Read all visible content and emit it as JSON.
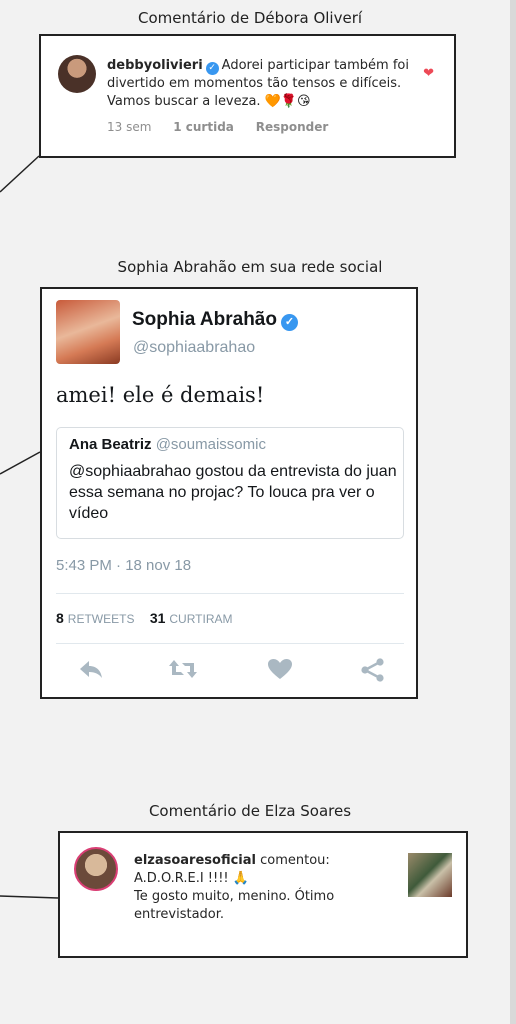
{
  "captions": {
    "debora": "Comentário de Débora Oliverí",
    "sophia": "Sophia Abrahão em sua rede social",
    "elza": "Comentário de Elza Soares"
  },
  "comment1": {
    "username": "debbyolivieri",
    "text": "Adorei participar também foi divertido em momentos tão tensos e difíceis. Vamos buscar a leveza. 🧡🌹😘",
    "time": "13 sem",
    "likes": "1 curtida",
    "reply": "Responder"
  },
  "tweet": {
    "name": "Sophia Abrahão",
    "handle": "@sophiaabrahao",
    "text": "amei! ele é demais!",
    "quote_name": "Ana Beatriz",
    "quote_handle": "@soumaissomic",
    "quote_text": "@sophiaabrahao gostou da entrevista do juan essa semana no projac? To louca pra ver o vídeo",
    "timestamp": "5:43 PM · 18 nov 18",
    "retweets_count": "8",
    "retweets_label": "RETWEETS",
    "likes_count": "31",
    "likes_label": "CURTIRAM"
  },
  "comment2": {
    "username": "elzasoaresoficial",
    "action": "comentou:",
    "line1": "A.D.O.R.E.I !!!! 🙏",
    "line2": "Te gosto muito, menino. Ótimo entrevistador."
  },
  "icons": {
    "verified": "check-badge",
    "heart": "heart-icon",
    "reply": "reply-icon",
    "retweet": "retweet-icon",
    "like": "heart-icon",
    "share": "share-icon"
  },
  "colors": {
    "ig_like": "#ed4956",
    "verified": "#3897f0",
    "twitter_gray": "#8899a6"
  }
}
